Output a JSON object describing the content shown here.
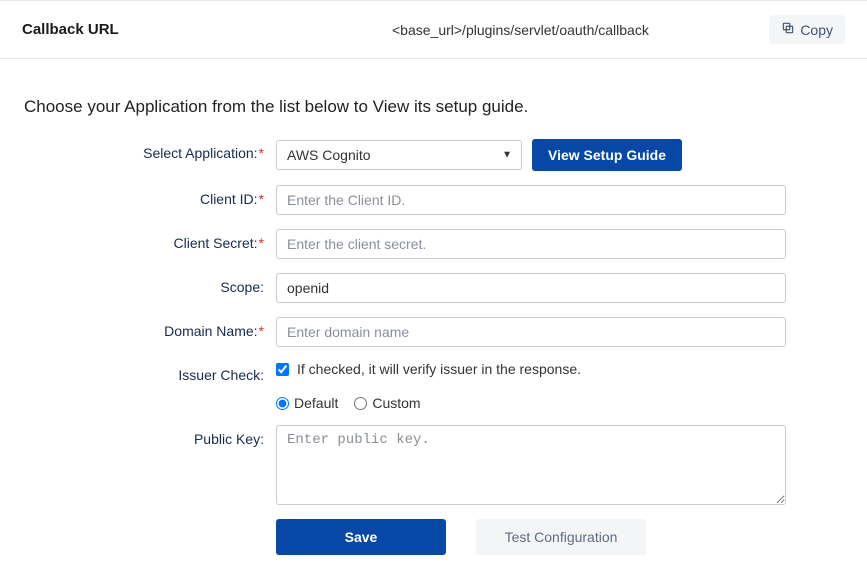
{
  "callback": {
    "label": "Callback URL",
    "value": "<base_url>/plugins/servlet/oauth/callback",
    "copy": "Copy"
  },
  "intro": "Choose your Application from the list below to View its setup guide.",
  "form": {
    "select_app_label": "Select Application:",
    "select_app_value": "AWS Cognito",
    "view_guide": "View Setup Guide",
    "client_id_label": "Client ID:",
    "client_id_value": "",
    "client_id_placeholder": "Enter the Client ID.",
    "client_secret_label": "Client Secret:",
    "client_secret_value": "",
    "client_secret_placeholder": "Enter the client secret.",
    "scope_label": "Scope:",
    "scope_value": "openid",
    "domain_label": "Domain Name:",
    "domain_value": "",
    "domain_placeholder": "Enter domain name",
    "issuer_label": "Issuer Check:",
    "issuer_text": "If checked, it will verify issuer in the response.",
    "issuer_checked": true,
    "radio_default": "Default",
    "radio_custom": "Custom",
    "radio_selected": "default",
    "public_key_label": "Public Key:",
    "public_key_value": "",
    "public_key_placeholder": "Enter public key.",
    "save": "Save",
    "test": "Test Configuration"
  }
}
